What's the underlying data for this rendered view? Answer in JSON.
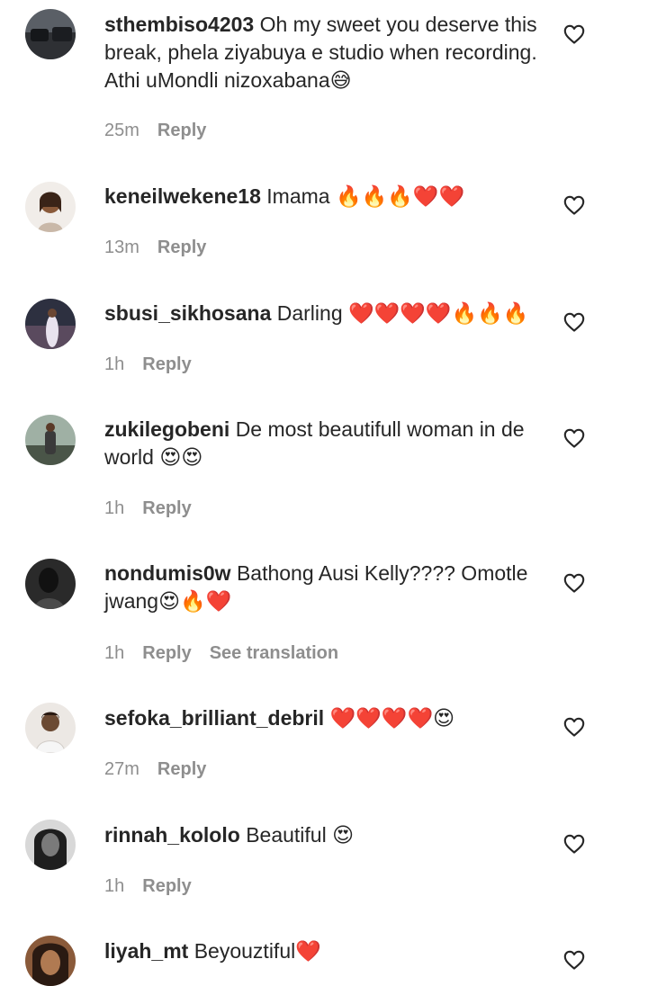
{
  "comments": [
    {
      "username": "sthembiso4203",
      "text": "Oh my sweet you deserve this break, phela ziyabuya e studio when recording. Athi uMondli nizoxabana",
      "emoji": "😅",
      "time": "25m",
      "reply": "Reply",
      "avatar_colors": [
        "#3a3a3a",
        "#9aa0a6"
      ]
    },
    {
      "username": "keneilwekene18",
      "text": "Imama",
      "emoji": "🔥🔥🔥❤️❤️",
      "time": "13m",
      "reply": "Reply",
      "avatar_colors": [
        "#f3ece6",
        "#7a4a2c"
      ]
    },
    {
      "username": "sbusi_sikhosana",
      "text": "Darling",
      "emoji": "❤️❤️❤️❤️🔥🔥🔥",
      "time": "1h",
      "reply": "Reply",
      "avatar_colors": [
        "#2c2f3a",
        "#d9d4e6"
      ]
    },
    {
      "username": "zukilegobeni",
      "text": "De most beautifull woman in de world",
      "emoji": "😍😍",
      "time": "1h",
      "reply": "Reply",
      "avatar_colors": [
        "#4d5a52",
        "#b8c4bb"
      ]
    },
    {
      "username": "nondumis0w",
      "text": "Bathong Ausi Kelly???? Omotle jwang",
      "emoji": "😍🔥❤️",
      "time": "1h",
      "reply": "Reply",
      "see_translation": "See translation",
      "avatar_colors": [
        "#1d1d1d",
        "#6b6b6b"
      ]
    },
    {
      "username": "sefoka_brilliant_debril",
      "text": "",
      "emoji": "❤️❤️❤️❤️😍",
      "time": "27m",
      "reply": "Reply",
      "avatar_colors": [
        "#e9e4df",
        "#6b4a33"
      ]
    },
    {
      "username": "rinnah_kololo",
      "text": "Beautiful",
      "emoji": "😍",
      "time": "1h",
      "reply": "Reply",
      "avatar_colors": [
        "#cfcfcf",
        "#2a2a2a"
      ]
    },
    {
      "username": "liyah_mt",
      "text": "Beyouztiful",
      "emoji": "❤️",
      "time": "",
      "reply": "",
      "avatar_colors": [
        "#8a5a3a",
        "#2a1a12"
      ]
    }
  ]
}
